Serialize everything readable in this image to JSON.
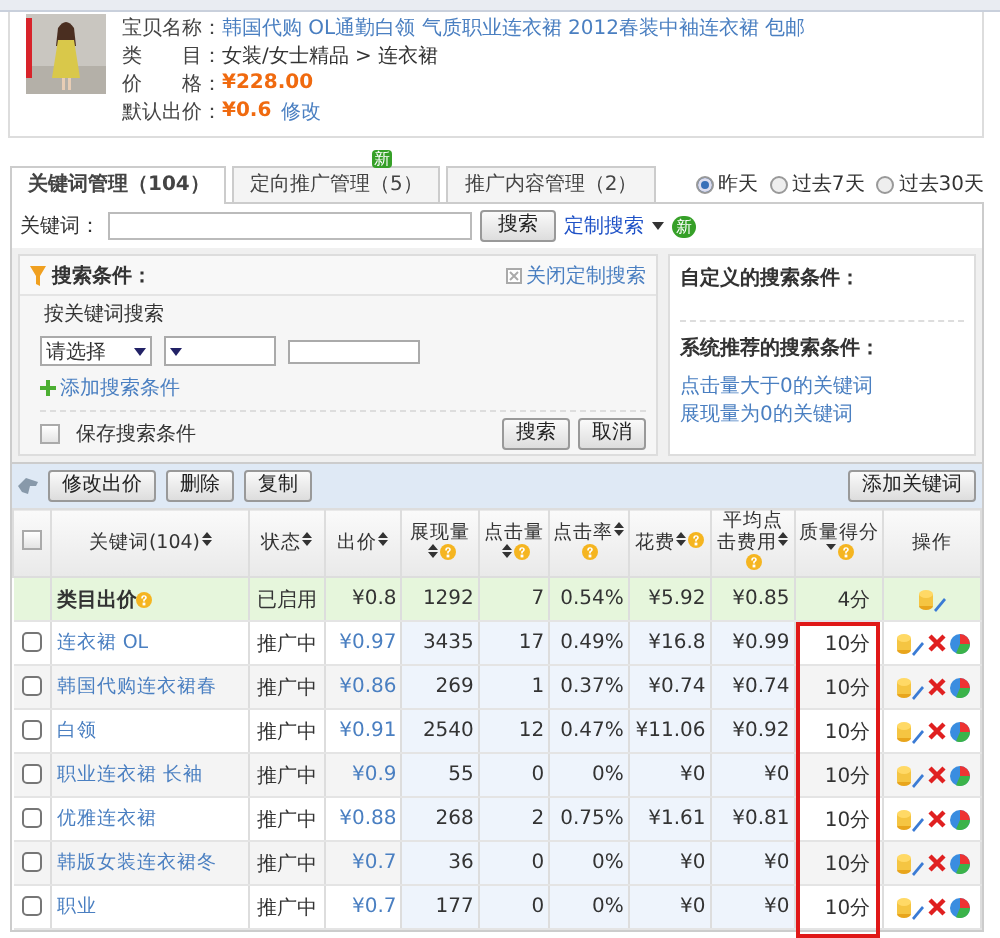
{
  "product": {
    "name_label": "宝贝名称：",
    "name": "韩国代购 OL通勤白领 气质职业连衣裙 2012春装中袖连衣裙 包邮",
    "category_label": "类　　目：",
    "category": "女装/女士精品 > 连衣裙",
    "price_label": "价　　格：",
    "price": "¥228.00",
    "bid_label": "默认出价：",
    "bid": "¥0.6",
    "edit_link": "修改"
  },
  "tabs": [
    {
      "label": "关键词管理（104）",
      "selected": true
    },
    {
      "label": "定向推广管理（5）",
      "selected": false,
      "badge": "新"
    },
    {
      "label": "推广内容管理（2）",
      "selected": false
    }
  ],
  "date_range": [
    {
      "label": "昨天",
      "selected": true
    },
    {
      "label": "过去7天",
      "selected": false
    },
    {
      "label": "过去30天",
      "selected": false
    }
  ],
  "keyword_search": {
    "label": "关键词：",
    "button": "搜索",
    "custom_link": "定制搜索",
    "badge": "新"
  },
  "conditions": {
    "title": "搜索条件：",
    "close_link": "关闭定制搜索",
    "section": "按关键词搜索",
    "select_1": "请选择",
    "add_link": "添加搜索条件",
    "save_label": "保存搜索条件",
    "save_checked": false,
    "buttons": [
      "搜索",
      "取消"
    ]
  },
  "custom_panel": {
    "title": "自定义的搜索条件：",
    "recommended_title": "系统推荐的搜索条件：",
    "links": [
      "点击量大于0的关键词",
      "展现量为0的关键词"
    ]
  },
  "toolbar": {
    "buttons": [
      "修改出价",
      "删除",
      "复制"
    ],
    "add_button": "添加关键词"
  },
  "table": {
    "all_checked": false,
    "columns": [
      {
        "label": "关键词(104)",
        "sortable": true,
        "descending": false,
        "help": false,
        "highlighted": false
      },
      {
        "label": "状态",
        "sortable": true,
        "descending": false,
        "help": false,
        "highlighted": false
      },
      {
        "label": "出价",
        "sortable": true,
        "descending": false,
        "help": false,
        "highlighted": false
      },
      {
        "label": "展现量",
        "sortable": true,
        "descending": false,
        "help": true,
        "highlighted": false
      },
      {
        "label": "点击量",
        "sortable": true,
        "descending": false,
        "help": true,
        "highlighted": false
      },
      {
        "label": "点击率",
        "sortable": true,
        "descending": false,
        "help": true,
        "highlighted": false
      },
      {
        "label": "花费",
        "sortable": true,
        "descending": false,
        "help": true,
        "highlighted": false
      },
      {
        "label": "平均点击费用",
        "sortable": true,
        "descending": false,
        "help": true,
        "highlighted": false
      },
      {
        "label": "质量得分",
        "sortable": true,
        "descending": true,
        "help": true,
        "highlighted": true
      },
      {
        "label": "操作",
        "sortable": false,
        "descending": false,
        "help": false,
        "highlighted": false
      }
    ],
    "rows": [
      {
        "kind": "category",
        "cells": [
          "类目出价",
          "已启用",
          "¥0.8",
          "1292",
          "7",
          "0.54%",
          "¥5.92",
          "¥0.85",
          "4分"
        ],
        "actions": [
          {
            "kind": "edit"
          }
        ]
      },
      {
        "kind": "keyword",
        "checked": false,
        "cells": [
          "连衣裙 OL",
          "推广中",
          "¥0.97",
          "3435",
          "17",
          "0.49%",
          "¥16.8",
          "¥0.99",
          "10分"
        ],
        "actions": [
          {
            "kind": "edit"
          },
          {
            "kind": "delete"
          },
          {
            "kind": "report"
          }
        ]
      },
      {
        "kind": "keyword",
        "checked": false,
        "cells": [
          "韩国代购连衣裙春",
          "推广中",
          "¥0.86",
          "269",
          "1",
          "0.37%",
          "¥0.74",
          "¥0.74",
          "10分"
        ],
        "actions": [
          {
            "kind": "edit"
          },
          {
            "kind": "delete"
          },
          {
            "kind": "report"
          }
        ]
      },
      {
        "kind": "keyword",
        "checked": false,
        "cells": [
          "白领",
          "推广中",
          "¥0.91",
          "2540",
          "12",
          "0.47%",
          "¥11.06",
          "¥0.92",
          "10分"
        ],
        "actions": [
          {
            "kind": "edit"
          },
          {
            "kind": "delete"
          },
          {
            "kind": "report"
          }
        ]
      },
      {
        "kind": "keyword",
        "checked": false,
        "cells": [
          "职业连衣裙 长袖",
          "推广中",
          "¥0.9",
          "55",
          "0",
          "0%",
          "¥0",
          "¥0",
          "10分"
        ],
        "actions": [
          {
            "kind": "edit"
          },
          {
            "kind": "delete"
          },
          {
            "kind": "report"
          }
        ]
      },
      {
        "kind": "keyword",
        "checked": false,
        "cells": [
          "优雅连衣裙",
          "推广中",
          "¥0.88",
          "268",
          "2",
          "0.75%",
          "¥1.61",
          "¥0.81",
          "10分"
        ],
        "actions": [
          {
            "kind": "edit"
          },
          {
            "kind": "delete"
          },
          {
            "kind": "report"
          }
        ]
      },
      {
        "kind": "keyword",
        "checked": false,
        "cells": [
          "韩版女装连衣裙冬",
          "推广中",
          "¥0.7",
          "36",
          "0",
          "0%",
          "¥0",
          "¥0",
          "10分"
        ],
        "actions": [
          {
            "kind": "edit"
          },
          {
            "kind": "delete"
          },
          {
            "kind": "report"
          }
        ]
      },
      {
        "kind": "keyword",
        "checked": false,
        "cells": [
          "职业",
          "推广中",
          "¥0.7",
          "177",
          "0",
          "0%",
          "¥0",
          "¥0",
          "10分"
        ],
        "actions": [
          {
            "kind": "edit"
          },
          {
            "kind": "delete"
          },
          {
            "kind": "report"
          }
        ]
      }
    ]
  }
}
